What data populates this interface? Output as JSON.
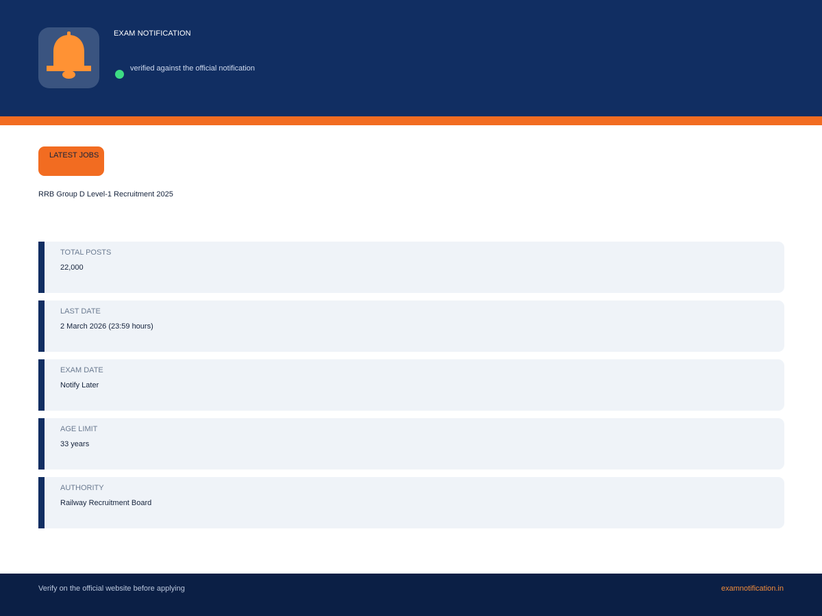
{
  "header": {
    "title": "EXAM NOTIFICATION",
    "verified_text": "verified against the official notification",
    "logo_icon": "bell-icon",
    "logo_color": "#ff9234"
  },
  "main": {
    "badge_label": "LATEST JOBS",
    "job_title": "RRB Group D Level-1 Recruitment 2025",
    "details": [
      {
        "label": "TOTAL POSTS",
        "value": "22,000"
      },
      {
        "label": "LAST DATE",
        "value": "2 March 2026 (23:59 hours)"
      },
      {
        "label": "EXAM DATE",
        "value": "Notify Later"
      },
      {
        "label": "AGE LIMIT",
        "value": "33 years"
      },
      {
        "label": "AUTHORITY",
        "value": "Railway Recruitment Board"
      }
    ]
  },
  "footer": {
    "note": "Verify on the official website before applying",
    "site": "examnotification.in"
  },
  "colors": {
    "header_bg": "#112e62",
    "accent": "#f26c21",
    "verified": "#3ddc84",
    "card_bg": "#eff3f8",
    "footer_bg": "#0b1f45"
  }
}
